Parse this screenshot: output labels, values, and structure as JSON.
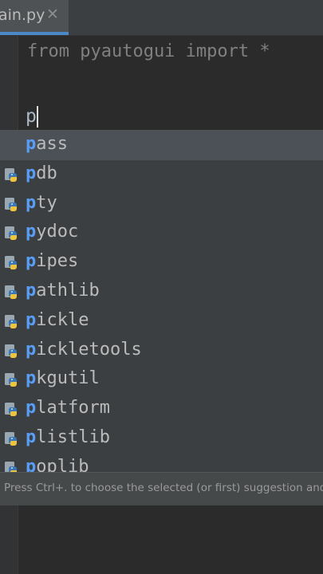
{
  "tab": {
    "label": "ain.py",
    "close_glyph": "✕"
  },
  "editor": {
    "line1": "from pyautogui import *",
    "typed": "p"
  },
  "completion": {
    "match_prefix": "p",
    "items": [
      {
        "label": "pass",
        "rest": "ass",
        "icon": "keyword",
        "selected": true
      },
      {
        "label": "pdb",
        "rest": "db",
        "icon": "python-module-icon"
      },
      {
        "label": "pty",
        "rest": "ty",
        "icon": "python-module-icon"
      },
      {
        "label": "pydoc",
        "rest": "ydoc",
        "icon": "python-module-icon"
      },
      {
        "label": "pipes",
        "rest": "ipes",
        "icon": "python-module-icon"
      },
      {
        "label": "pathlib",
        "rest": "athlib",
        "icon": "python-module-icon"
      },
      {
        "label": "pickle",
        "rest": "ickle",
        "icon": "python-module-icon"
      },
      {
        "label": "pickletools",
        "rest": "ickletools",
        "icon": "python-module-icon"
      },
      {
        "label": "pkgutil",
        "rest": "kgutil",
        "icon": "python-module-icon"
      },
      {
        "label": "platform",
        "rest": "latform",
        "icon": "python-module-icon"
      },
      {
        "label": "plistlib",
        "rest": "listlib",
        "icon": "python-module-icon"
      },
      {
        "label": "poplib",
        "rest": "oplib",
        "icon": "python-module-icon"
      }
    ],
    "hint": "Press Ctrl+. to choose the selected (or first) suggestion and insert a dot afterwards"
  },
  "colors": {
    "background": "#2b2b2b",
    "popup": "#3c3f41",
    "selection": "#4b5157",
    "match": "#589df6"
  }
}
